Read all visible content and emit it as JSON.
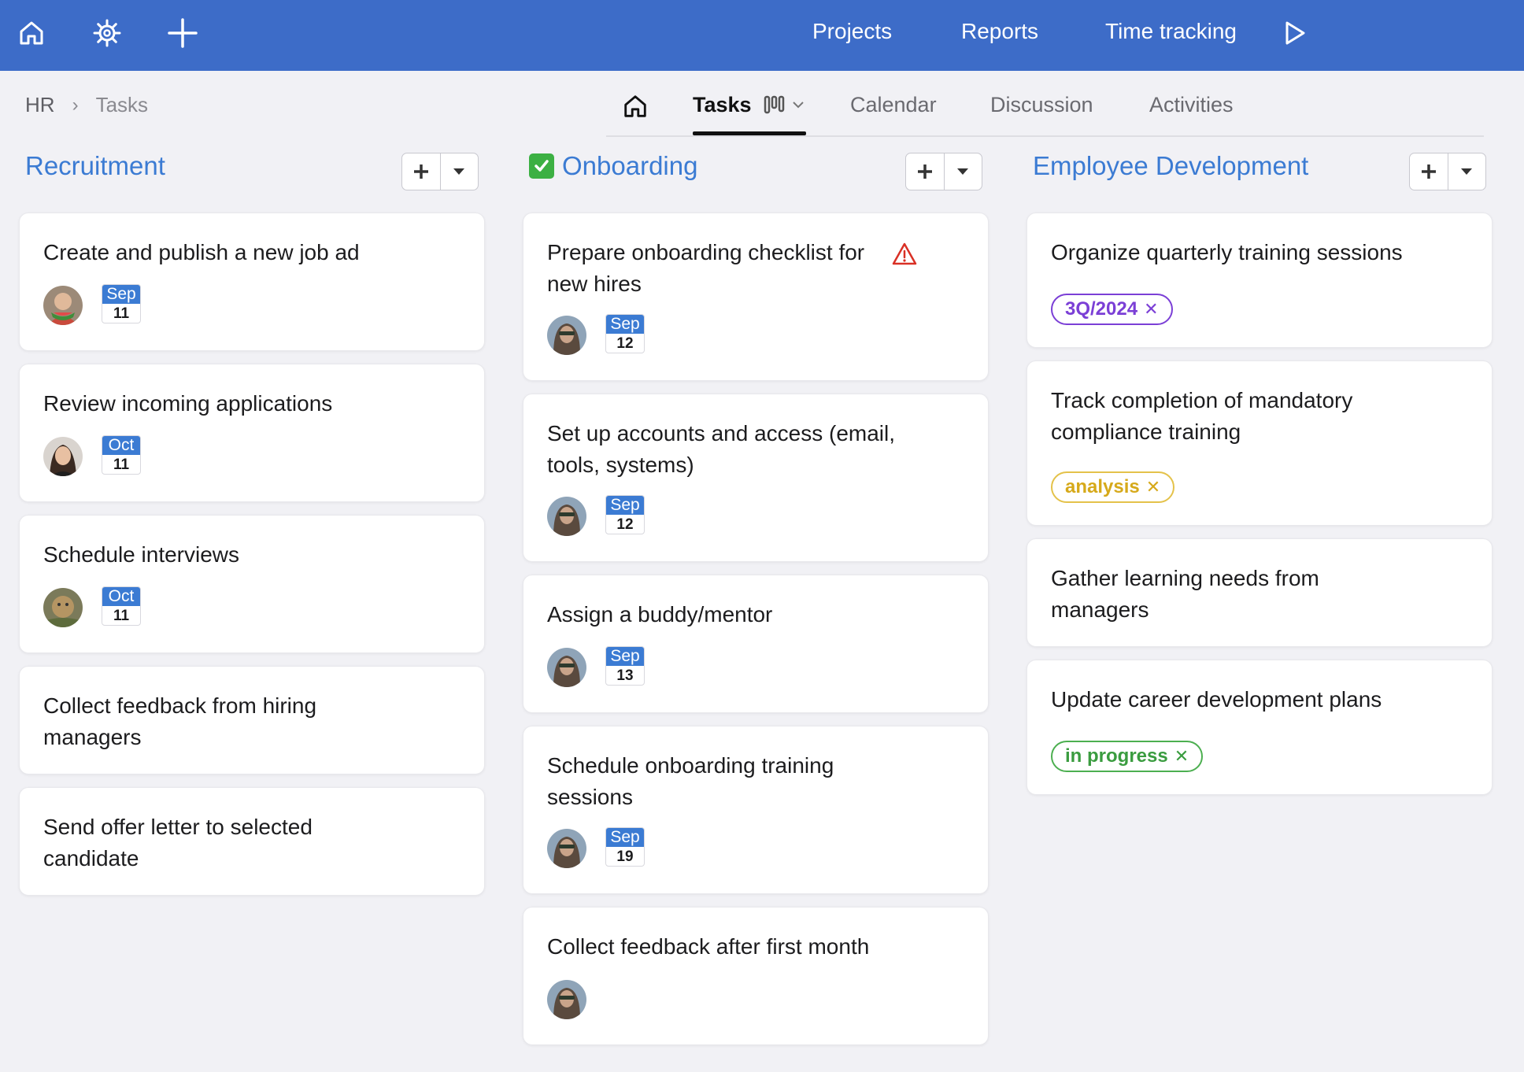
{
  "topbar": {
    "background": "#3d6cc8",
    "icons": [
      "home-icon",
      "settings-icon",
      "plus-icon",
      "play-icon"
    ],
    "links": [
      "Projects",
      "Reports",
      "Time tracking"
    ]
  },
  "breadcrumb": {
    "home": "HR",
    "current": "Tasks"
  },
  "tabs": [
    "Tasks",
    "Calendar",
    "Discussion",
    "Activities"
  ],
  "columns": [
    {
      "title": "Recruitment",
      "cards": [
        {
          "title": "Create and publish a new job ad",
          "month": "Sep",
          "day": "11"
        },
        {
          "title": "Review incoming applications",
          "month": "Oct",
          "day": "11"
        },
        {
          "title": "Schedule interviews",
          "month": "Oct",
          "day": "11"
        },
        {
          "title": "Collect feedback from hiring managers"
        },
        {
          "title": "Send offer letter to selected candidate"
        }
      ]
    },
    {
      "title": "Onboarding",
      "cards": [
        {
          "title": "Prepare onboarding checklist for new hires",
          "month": "Sep",
          "day": "12",
          "warning": "warning-icon"
        },
        {
          "title": "Set up accounts and access (email, tools, systems)",
          "month": "Sep",
          "day": "12"
        },
        {
          "title": "Assign a buddy/mentor",
          "month": "Sep",
          "day": "13"
        },
        {
          "title": "Schedule onboarding training sessions",
          "month": "Sep",
          "day": "19"
        },
        {
          "title": "Collect feedback after first month"
        }
      ]
    },
    {
      "title": "Employee Development",
      "cards": [
        {
          "title": "Organize quarterly training sessions",
          "tag": "3Q/2024",
          "tag_color": "#7b3fd6"
        },
        {
          "title": "Track completion of mandatory compliance training",
          "tag": "analysis",
          "tag_color": "#d6a91a"
        },
        {
          "title": "Gather learning needs from managers"
        },
        {
          "title": "Update career development plans",
          "tag": "in progress",
          "tag_color": "#3a9c3f"
        }
      ]
    }
  ],
  "colors": {
    "accent": "#3b7bd3",
    "date_header": "#3b7bd3",
    "warning": "#d93025",
    "check": "#3cb043"
  }
}
